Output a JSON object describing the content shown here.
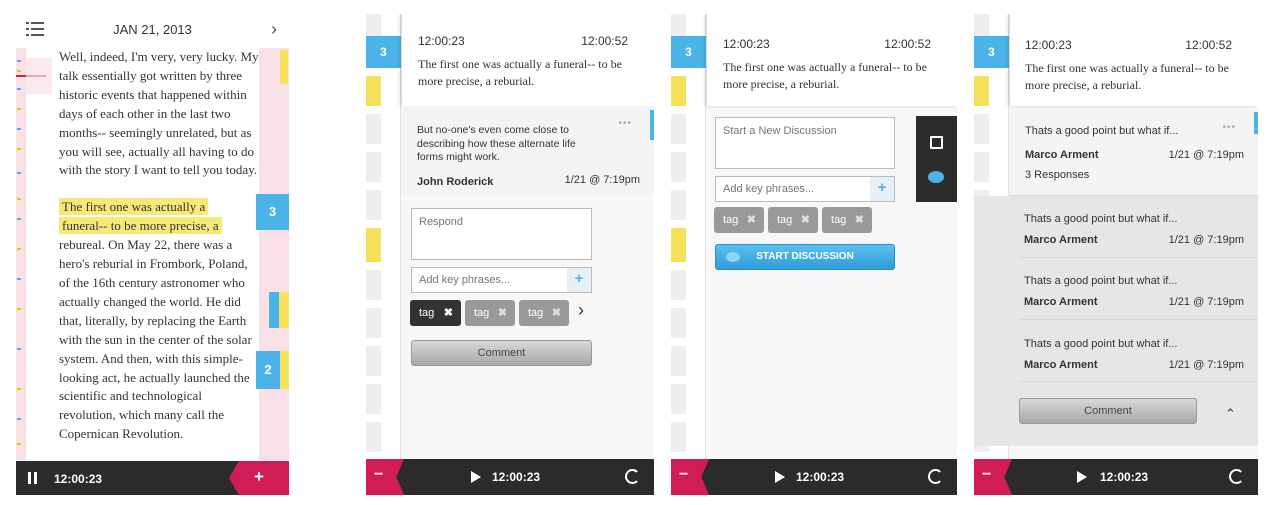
{
  "colors": {
    "accent": "#d11d55",
    "blue": "#4bb3e8",
    "yellow": "#f5e25a",
    "pink": "#f9dfe6",
    "dark": "#2b2b2b"
  },
  "reader": {
    "date": "JAN 21, 2013",
    "menu_icon": "list-icon",
    "next_icon": "chevron-right-icon",
    "paragraph1": "Well, indeed, I'm very, very lucky. My talk essentially got written by three historic events that happened within days of each other in the last two months-- seemingly unrelated, but as you will see, actually all having to do with the story I want to tell you today.",
    "highlight_line1": "The first one was actually a",
    "highlight_line2": "funeral-- to be more precise, a",
    "paragraph2": "rebureal. On May 22, there was a hero's reburial in Frombork, Poland, of the 16th century astronomer who actually changed the world. He did that, literally, by replacing the Earth with the sun in the center of the solar system. And then, with this simple-looking act, he actually launched the scientific and technological revolution, which many call the Copernican Revolution.",
    "marker_top": "3",
    "marker_bottom": "2",
    "time": "12:00:23",
    "pause_icon": "pause-icon",
    "add_label": "+"
  },
  "common": {
    "start_time": "12:00:23",
    "end_time": "12:00:52",
    "quote": "The first one was actually a funeral-- to be more precise, a reburial.",
    "strip_number": "3",
    "time": "12:00:23",
    "minus": "−",
    "play_icon": "play-icon",
    "refresh_icon": "refresh-icon"
  },
  "respond": {
    "comment": "But no-one's even come close to describing how these alternate life forms might work.",
    "author": "John Roderick",
    "date": "1/21 @ 7:19pm",
    "more": "•••",
    "respond_placeholder": "Respond",
    "phrase_placeholder": "Add key phrases...",
    "plus": "+",
    "tags": [
      "tag",
      "tag",
      "tag"
    ],
    "remove": "✖",
    "more_tags": "›",
    "comment_button": "Comment"
  },
  "discussion": {
    "placeholder": "Start a New Discussion",
    "phrase_placeholder": "Add key phrases...",
    "plus": "+",
    "tags": [
      "tag",
      "tag",
      "tag"
    ],
    "remove": "✖",
    "start_button": "START DISCUSSION",
    "edit_icon": "edit-icon",
    "chat_icon": "chat-bubbles-icon"
  },
  "thread": {
    "top": {
      "text": "Thats a good point but what if...",
      "author": "Marco Arment",
      "date": "1/21 @ 7:19pm",
      "responses": "3 Responses",
      "more": "•••"
    },
    "replies": [
      {
        "text": "Thats a good point but what if...",
        "author": "Marco Arment",
        "date": "1/21 @ 7:19pm"
      },
      {
        "text": "Thats a good point but what if...",
        "author": "Marco Arment",
        "date": "1/21 @ 7:19pm"
      },
      {
        "text": "Thats a good point but what if...",
        "author": "Marco Arment",
        "date": "1/21 @ 7:19pm"
      }
    ],
    "comment_button": "Comment",
    "collapse_icon": "chevron-up-icon",
    "collapse_glyph": "⌃"
  }
}
